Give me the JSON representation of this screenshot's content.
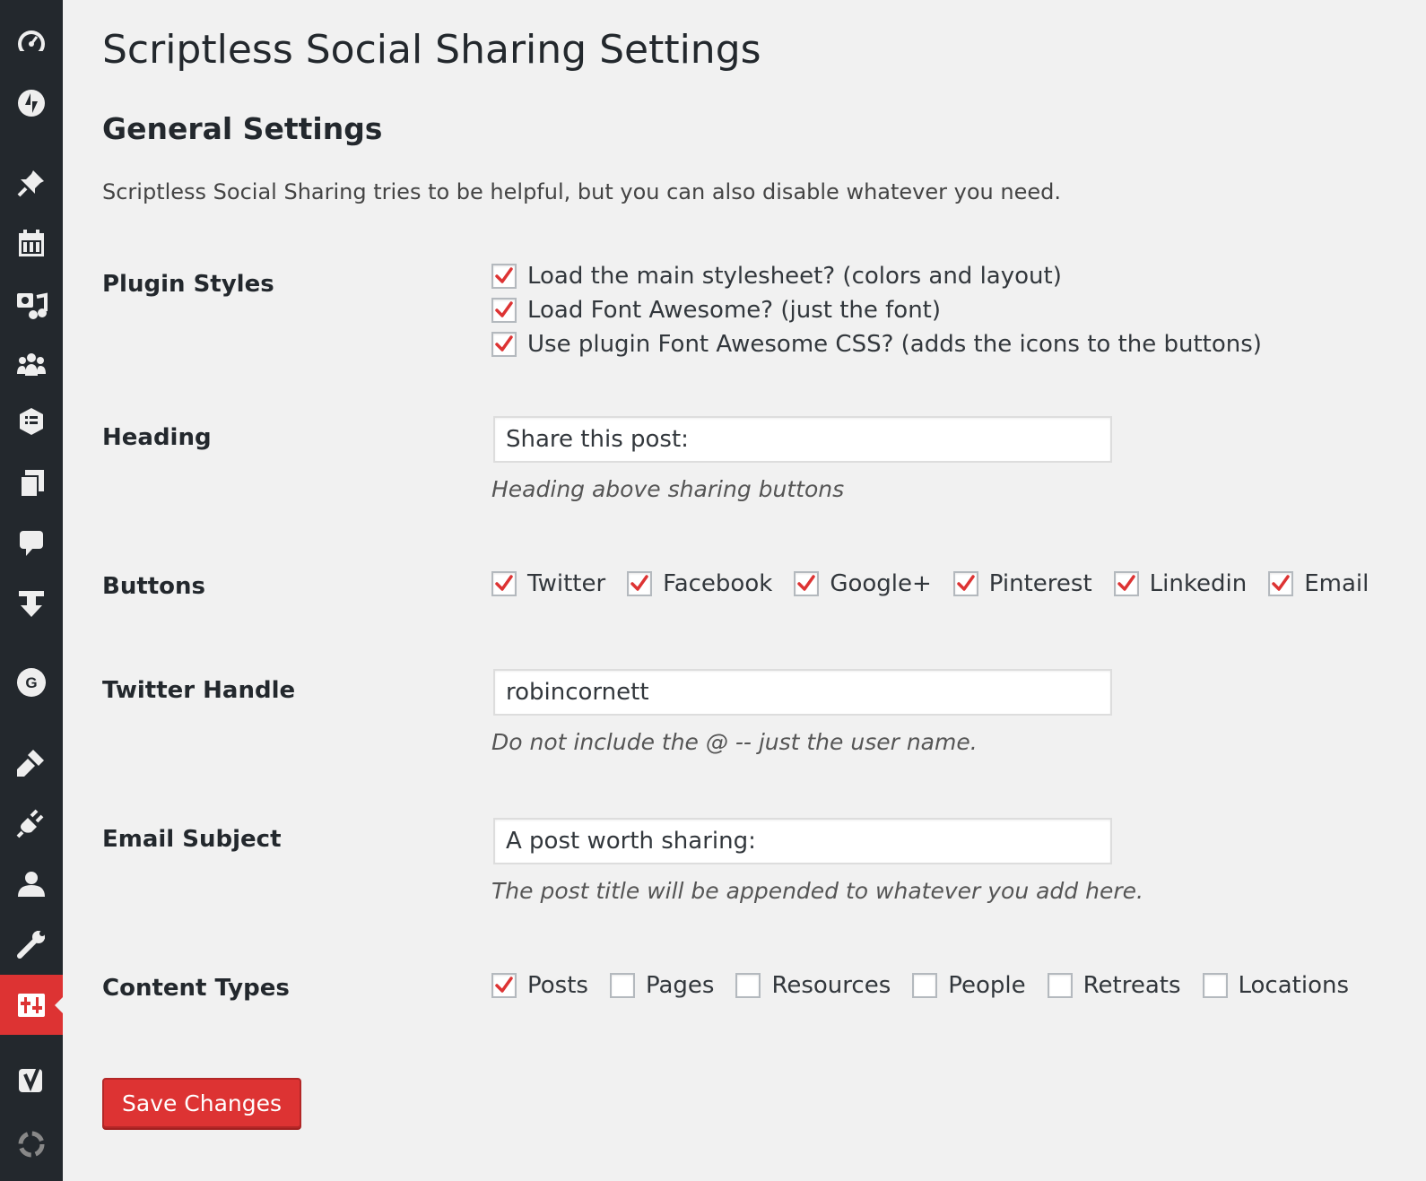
{
  "colors": {
    "sidebar_bg": "#23282d",
    "accent": "#dd3333",
    "page_bg": "#f1f1f1"
  },
  "sidebar": {
    "icons": [
      "dashboard-icon",
      "jetpack-icon",
      "posts-pin-icon",
      "calendar-icon",
      "media-icon",
      "groups-icon",
      "forms-list-icon",
      "pages-icon",
      "comments-icon",
      "download-icon",
      "g-icon",
      "appearance-icon",
      "plugins-icon",
      "users-icon",
      "tools-icon",
      "settings-active-icon",
      "yoast-icon",
      "updraft-icon"
    ]
  },
  "page": {
    "title": "Scriptless Social Sharing Settings",
    "section_title": "General Settings",
    "section_desc": "Scriptless Social Sharing tries to be helpful, but you can also disable whatever you need."
  },
  "plugin_styles": {
    "label": "Plugin Styles",
    "options": [
      {
        "label": "Load the main stylesheet? (colors and layout)",
        "checked": true
      },
      {
        "label": "Load Font Awesome? (just the font)",
        "checked": true
      },
      {
        "label": "Use plugin Font Awesome CSS? (adds the icons to the buttons)",
        "checked": true
      }
    ]
  },
  "heading": {
    "label": "Heading",
    "value": "Share this post:",
    "description": "Heading above sharing buttons"
  },
  "buttons": {
    "label": "Buttons",
    "options": [
      {
        "label": "Twitter",
        "checked": true
      },
      {
        "label": "Facebook",
        "checked": true
      },
      {
        "label": "Google+",
        "checked": true
      },
      {
        "label": "Pinterest",
        "checked": true
      },
      {
        "label": "Linkedin",
        "checked": true
      },
      {
        "label": "Email",
        "checked": true
      }
    ]
  },
  "twitter_handle": {
    "label": "Twitter Handle",
    "value": "robincornett",
    "description": "Do not include the @ -- just the user name."
  },
  "email_subject": {
    "label": "Email Subject",
    "value": "A post worth sharing:",
    "description": "The post title will be appended to whatever you add here."
  },
  "content_types": {
    "label": "Content Types",
    "options": [
      {
        "label": "Posts",
        "checked": true
      },
      {
        "label": "Pages",
        "checked": false
      },
      {
        "label": "Resources",
        "checked": false
      },
      {
        "label": "People",
        "checked": false
      },
      {
        "label": "Retreats",
        "checked": false
      },
      {
        "label": "Locations",
        "checked": false
      }
    ]
  },
  "save_button": {
    "label": "Save Changes"
  }
}
